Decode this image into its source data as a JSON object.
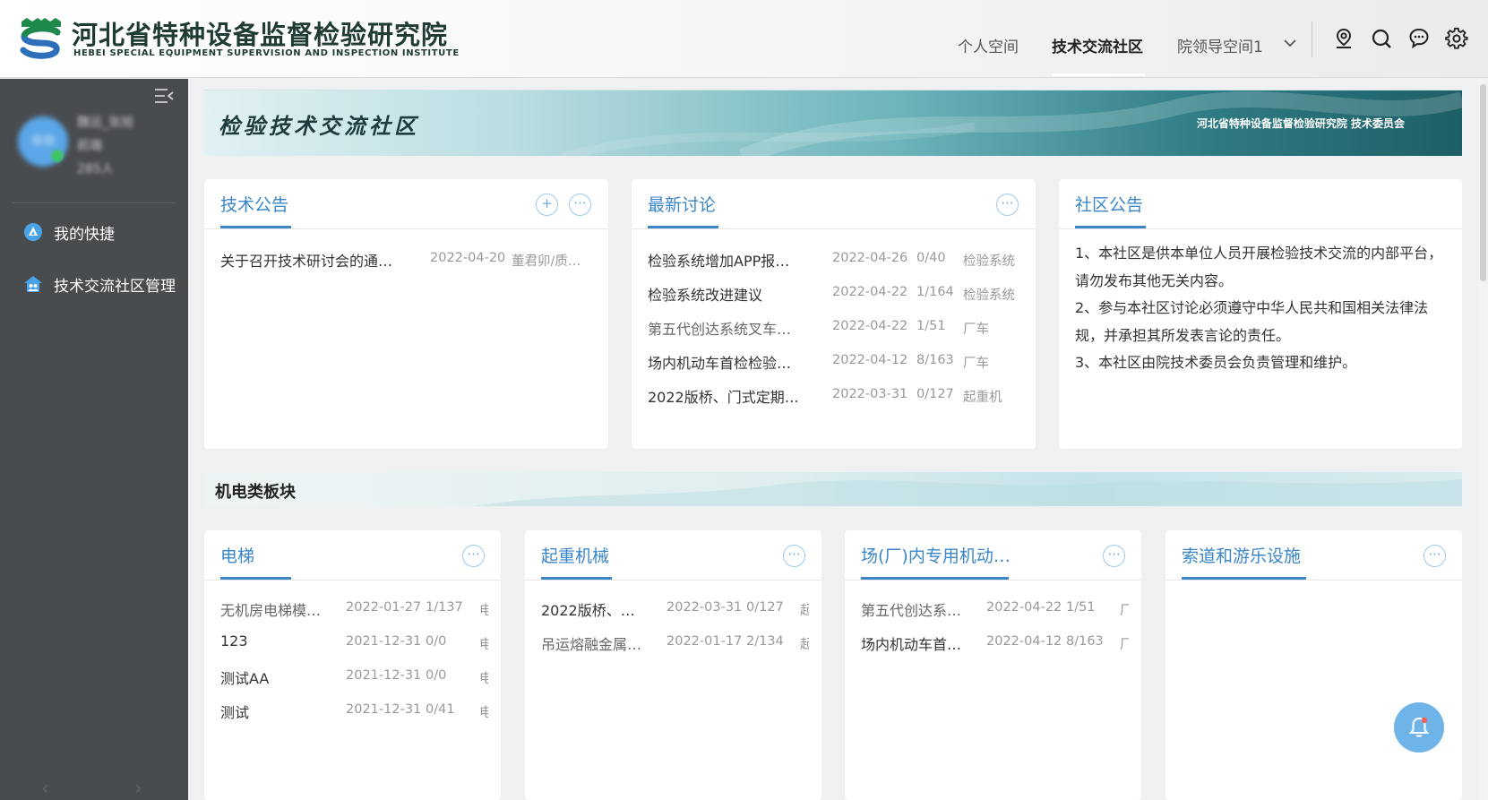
{
  "header": {
    "org_name_cn": "河北省特种设备监督检验研究院",
    "org_name_en": "HEBEI SPECIAL EQUIPMENT SUPERVISION AND INSPECTION  INSTITUTE",
    "nav": [
      "个人空间",
      "技术交流社区",
      "院领导空间1"
    ],
    "active_nav": "技术交流社区",
    "icons": [
      "location-icon",
      "search-icon",
      "chat-icon",
      "gear-icon"
    ]
  },
  "sidebar": {
    "user_name": "魏远_张旭",
    "user_role": "前端",
    "user_count": "285人",
    "avatar_text": "张旭",
    "items": [
      {
        "label": "我的快捷",
        "icon": "shortcut-icon"
      },
      {
        "label": "技术交流社区管理",
        "icon": "community-icon"
      }
    ]
  },
  "banner": {
    "title": "检验技术交流社区",
    "subtitle": "河北省特种设备监督检验研究院  技术委员会"
  },
  "tech_notice": {
    "title": "技术公告",
    "rows": [
      {
        "title": "关于召开技术研讨会的通…",
        "date": "2022-04-20",
        "author": "董君卯/质…"
      }
    ]
  },
  "latest_discussion": {
    "title": "最新讨论",
    "rows": [
      {
        "title": "检验系统增加APP报…",
        "date": "2022-04-26",
        "count": "0/40",
        "group": "检验系统"
      },
      {
        "title": "检验系统改进建议",
        "date": "2022-04-22",
        "count": "1/164",
        "group": "检验系统"
      },
      {
        "title": "第五代创达系统叉车…",
        "date": "2022-04-22",
        "count": "1/51",
        "group": "厂车"
      },
      {
        "title": "场内机动车首检检验…",
        "date": "2022-04-12",
        "count": "8/163",
        "group": "厂车"
      },
      {
        "title": "2022版桥、门式定期…",
        "date": "2022-03-31",
        "count": "0/127",
        "group": "起重机"
      }
    ]
  },
  "community_notice": {
    "title": "社区公告",
    "text": [
      "1、本社区是供本单位人员开展检验技术交流的内部平台，请勿发布其他无关内容。",
      "2、参与本社区讨论必须遵守中华人民共和国相关法律法规，并承担其所发表言论的责任。",
      "3、本社区由院技术委员会负责管理和维护。"
    ]
  },
  "section": {
    "title": "机电类板块"
  },
  "boards": [
    {
      "title": "电梯",
      "rows": [
        {
          "title": "无机房电梯模…",
          "date": "2022-01-27",
          "count": "1/137",
          "group": "电"
        },
        {
          "title": "123",
          "date": "2021-12-31",
          "count": "0/0",
          "group": "电"
        },
        {
          "title": "测试AA",
          "date": "2021-12-31",
          "count": "0/0",
          "group": "电"
        },
        {
          "title": "测试",
          "date": "2021-12-31",
          "count": "0/41",
          "group": "电"
        }
      ]
    },
    {
      "title": "起重机械",
      "rows": [
        {
          "title": "2022版桥、…",
          "date": "2022-03-31",
          "count": "0/127",
          "group": "起"
        },
        {
          "title": "吊运熔融金属…",
          "date": "2022-01-17",
          "count": "2/134",
          "group": "起"
        }
      ]
    },
    {
      "title": "场(厂)内专用机动…",
      "rows": [
        {
          "title": "第五代创达系…",
          "date": "2022-04-22",
          "count": "1/51",
          "group": "厂"
        },
        {
          "title": "场内机动车首…",
          "date": "2022-04-12",
          "count": "8/163",
          "group": "厂"
        }
      ]
    },
    {
      "title": "索道和游乐设施",
      "rows": []
    }
  ]
}
